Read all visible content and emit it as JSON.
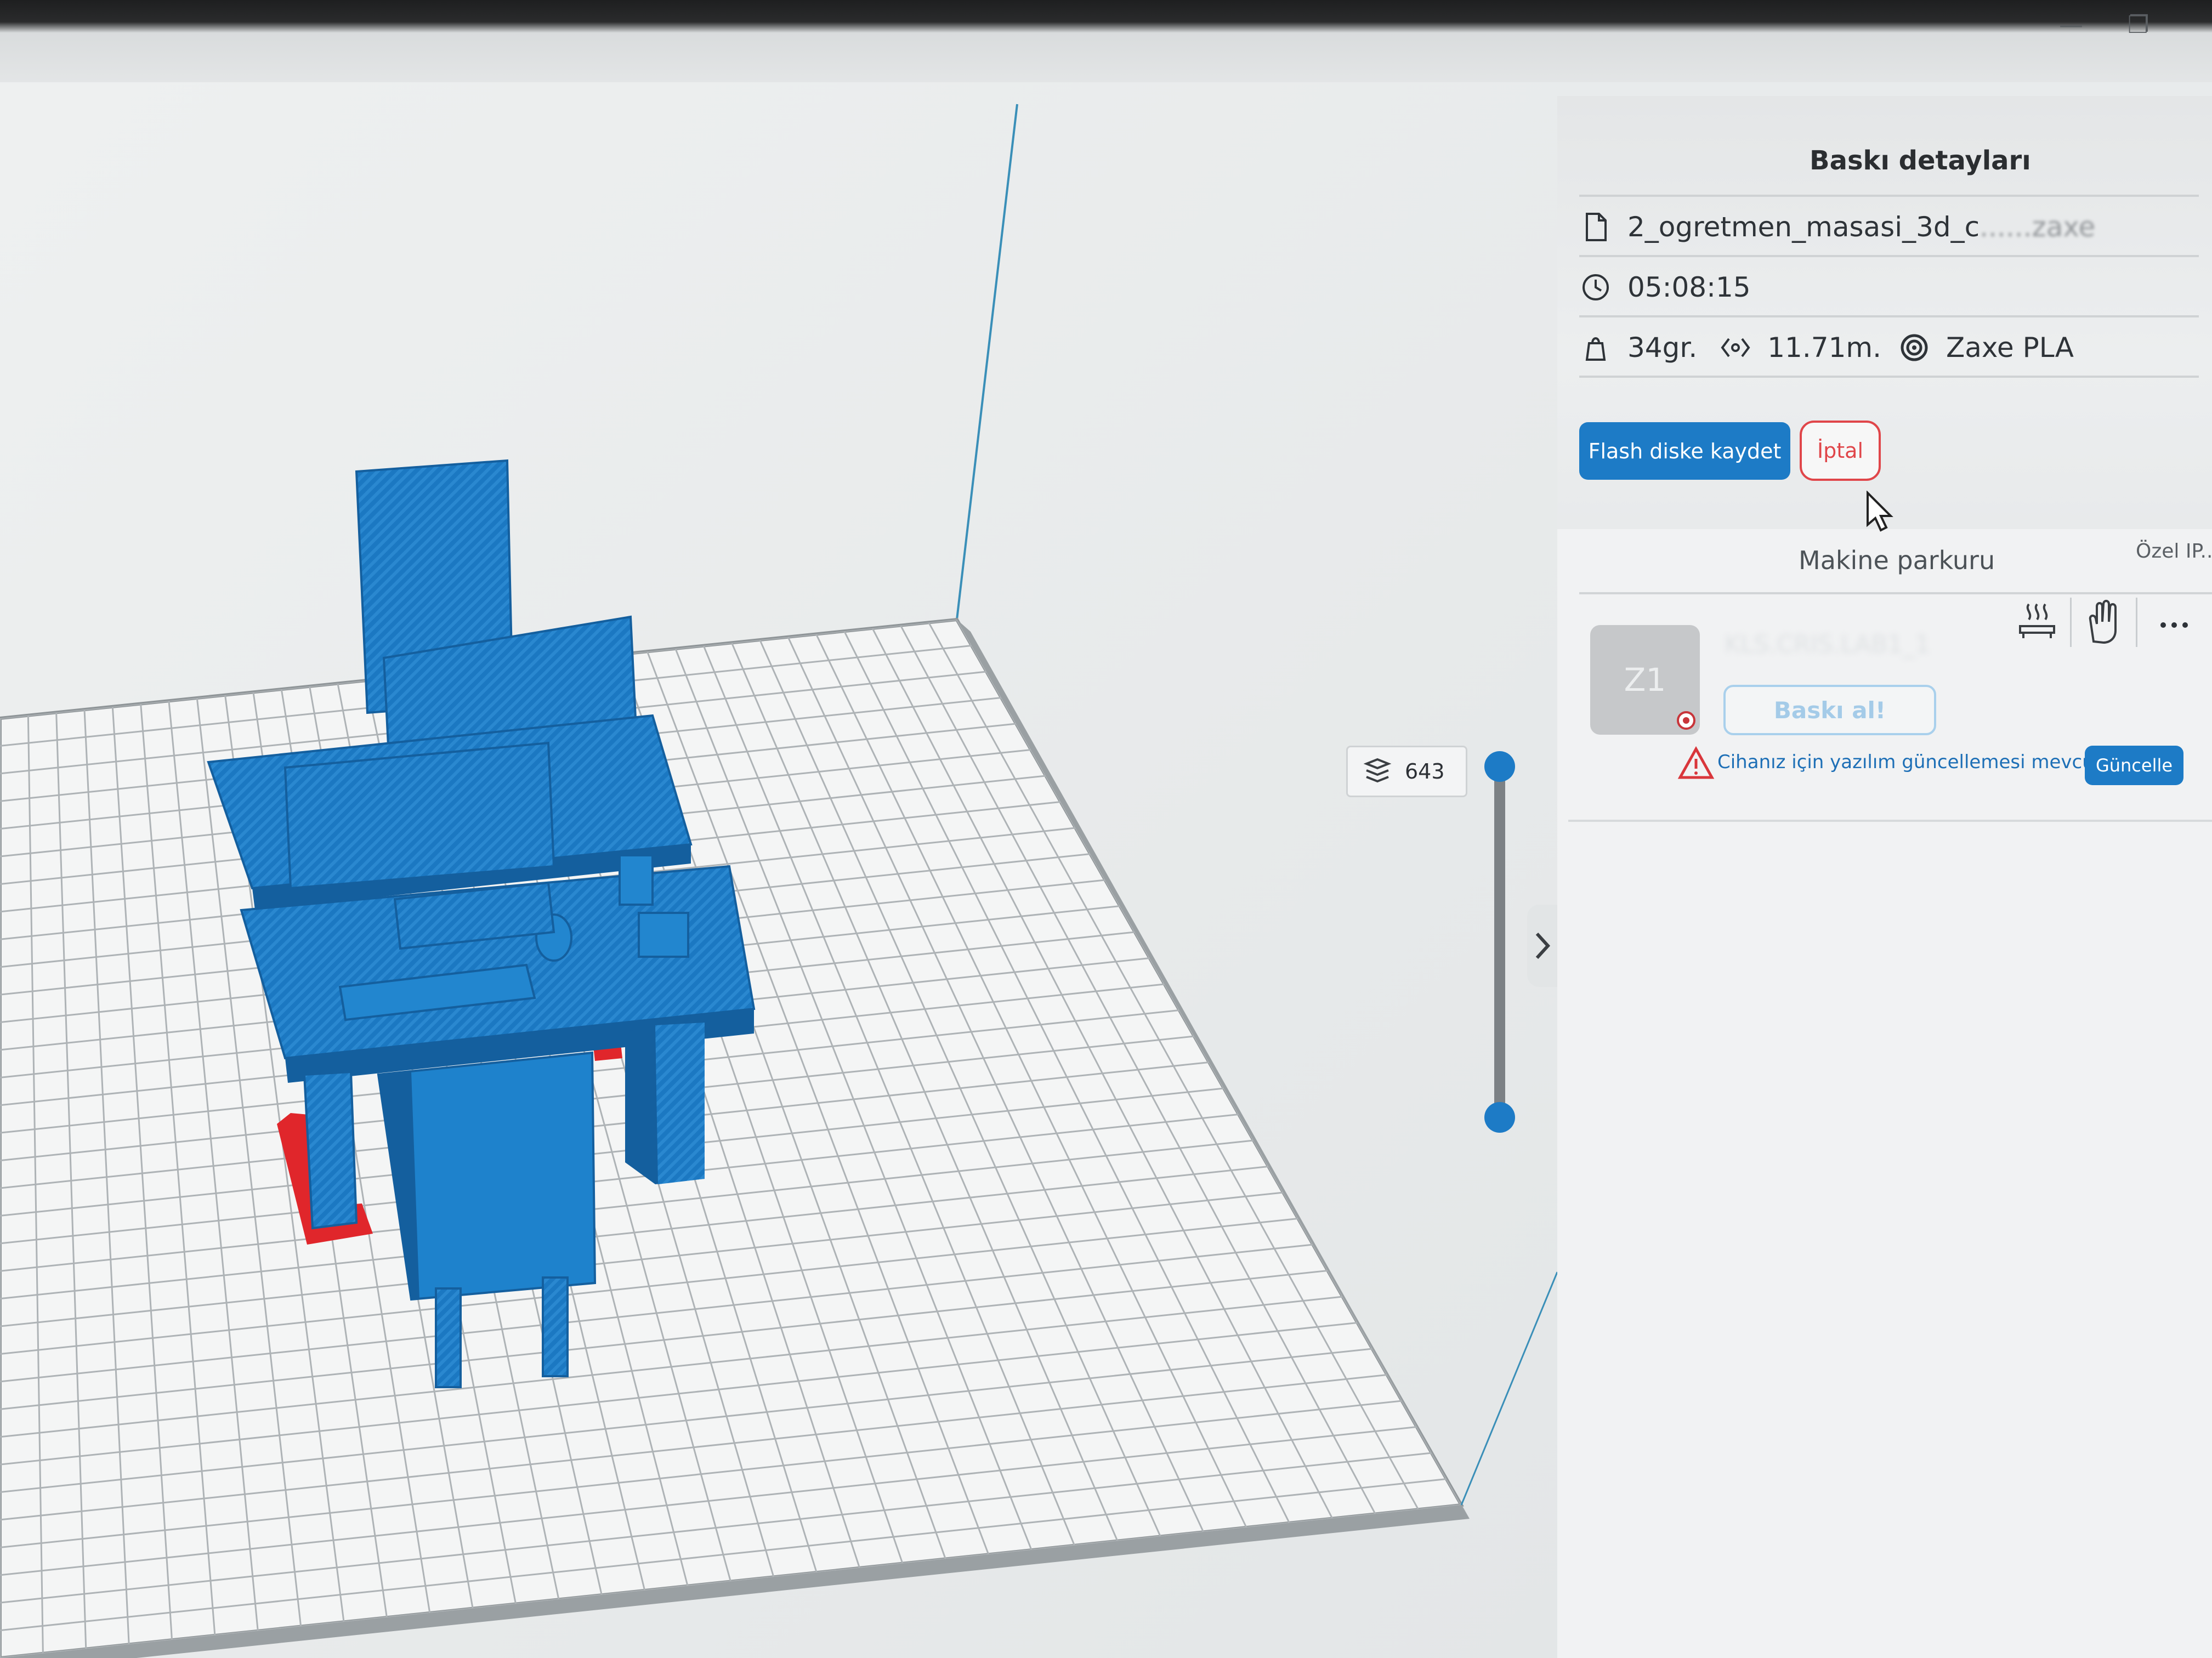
{
  "window": {
    "minimize_glyph": "—",
    "restore_glyph": "❐"
  },
  "print_details": {
    "title": "Baskı detayları",
    "file_name": "2_ogretmen_masasi_3d_c",
    "file_name_hidden_suffix": "......zaxe",
    "print_time": "05:08:15",
    "weight": "34gr.",
    "filament_length": "11.71m.",
    "material": "Zaxe PLA",
    "save_label": "Flash diske kaydet",
    "cancel_label": "İptal"
  },
  "fleet": {
    "title": "Makine parkuru",
    "custom_ip_label": "Özel IP...",
    "machine": {
      "model": "Z1",
      "name": "KLS.CRIS.LAB1_1",
      "print_label": "Baskı al!",
      "status_color": "#c8353a"
    },
    "warning": "Cihanız için yazılım güncellemesi mevcut",
    "update_label": "Güncelle",
    "tool_icons": [
      "heater-icon",
      "hand-icon",
      "more-icon"
    ]
  },
  "layer_slider": {
    "value": "643",
    "position": 1.0
  },
  "colors": {
    "accent": "#1d7bc6",
    "cancel": "#e0464a",
    "model": "#1b78c2",
    "support": "#e0262b"
  }
}
